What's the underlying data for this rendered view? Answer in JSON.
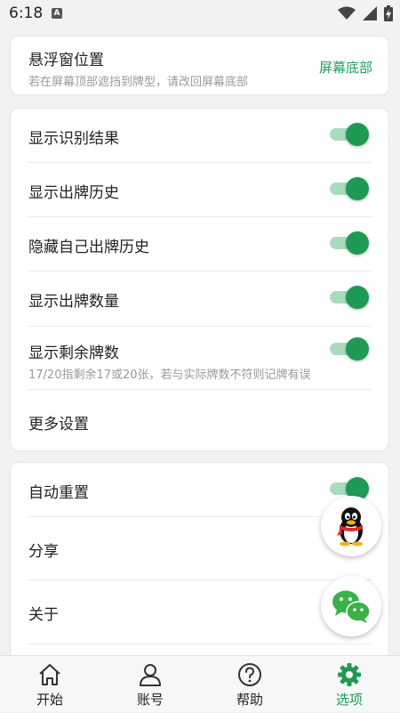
{
  "status_bar": {
    "time": "6:18",
    "notif_badge": "A"
  },
  "float_window": {
    "title": "悬浮窗位置",
    "subtitle": "若在屏幕顶部遮挡到牌型，请改回屏幕底部",
    "value": "屏幕底部"
  },
  "display_settings": [
    {
      "label": "显示识别结果",
      "on": true
    },
    {
      "label": "显示出牌历史",
      "on": true
    },
    {
      "label": "隐藏自己出牌历史",
      "on": true
    },
    {
      "label": "显示出牌数量",
      "on": true
    },
    {
      "label": "显示剩余牌数",
      "on": true,
      "subtitle": "17/20指剩余17或20张，若与实际牌数不符则记牌有误"
    }
  ],
  "more_settings": "更多设置",
  "other_settings": {
    "auto_reset": {
      "label": "自动重置",
      "on": true
    },
    "share": "分享",
    "about": "关于"
  },
  "bottom_nav": [
    {
      "label": "开始",
      "icon": "home-icon"
    },
    {
      "label": "账号",
      "icon": "person-icon"
    },
    {
      "label": "帮助",
      "icon": "help-icon"
    },
    {
      "label": "选项",
      "icon": "gear-icon",
      "active": true
    }
  ],
  "colors": {
    "accent": "#1f9a55",
    "accent_light": "#a9dcbf",
    "link": "#20a060"
  }
}
